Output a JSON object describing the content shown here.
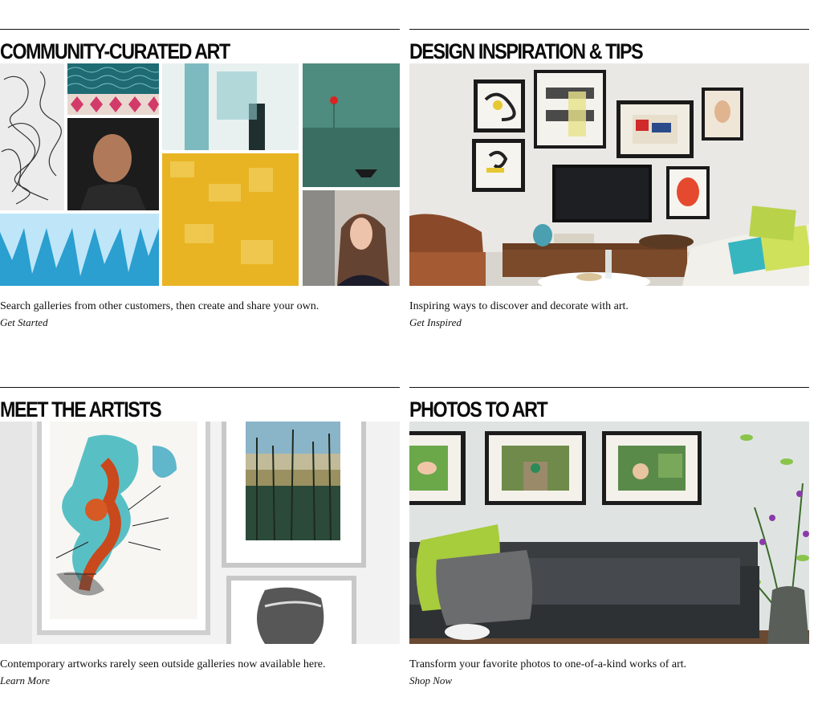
{
  "tiles": [
    {
      "title": "COMMUNITY-CURATED ART",
      "description": "Search galleries from other customers, then create and share your own.",
      "cta": "Get Started"
    },
    {
      "title": "DESIGN INSPIRATION & TIPS",
      "description": "Inspiring ways to discover and decorate with art.",
      "cta": "Get Inspired"
    },
    {
      "title": "MEET THE ARTISTS",
      "description": "Contemporary artworks rarely seen outside galleries now available here.",
      "cta": "Learn More"
    },
    {
      "title": "PHOTOS TO ART",
      "description": "Transform your favorite photos to one-of-a-kind works of art.",
      "cta": "Shop Now"
    }
  ],
  "colors": {
    "heading": "#0b0b0b",
    "rule": "#111111",
    "text": "#111111"
  }
}
